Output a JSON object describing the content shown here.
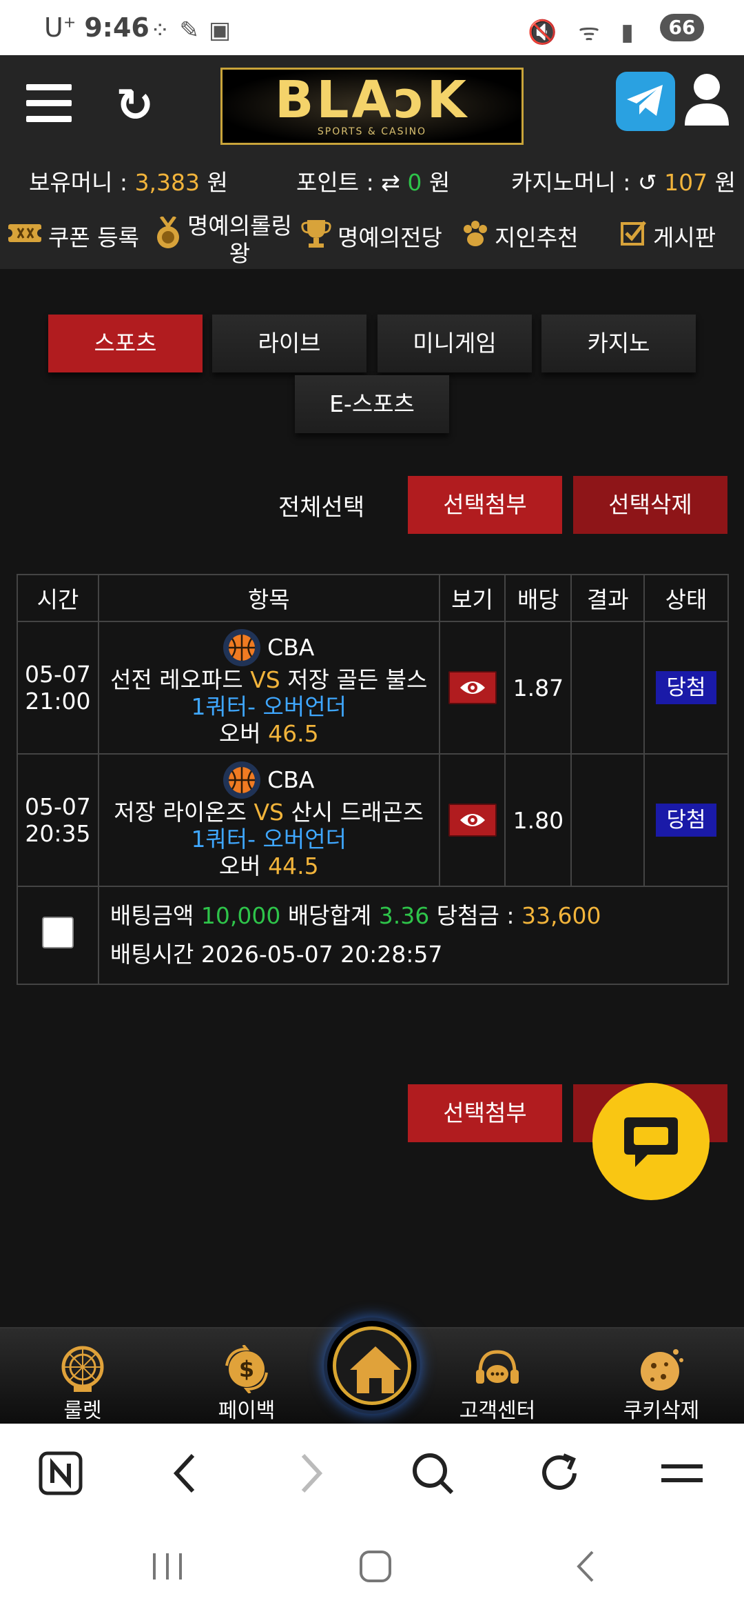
{
  "status_bar": {
    "carrier": "U",
    "carrier_sup": "+",
    "time": "9:46",
    "battery": "66"
  },
  "header": {
    "logo_text": "BLAɔK",
    "logo_sub": "SPORTS & CASINO"
  },
  "balances": {
    "money_label": "보유머니 :",
    "money_value": "3,383",
    "money_unit": "원",
    "point_label": "포인트 :",
    "point_value": "0",
    "point_unit": "원",
    "casino_label": "카지노머니 :",
    "casino_value": "107",
    "casino_unit": "원"
  },
  "nav": {
    "coupon": "쿠폰 등록",
    "honor_roll_1": "명예의롤링",
    "honor_roll_2": "왕",
    "hall_of_fame": "명예의전당",
    "referral": "지인추천",
    "board": "게시판"
  },
  "tabs": [
    "스포츠",
    "라이브",
    "미니게임",
    "카지노",
    "E-스포츠"
  ],
  "actions": {
    "select_all": "전체선택",
    "attach": "선택첨부",
    "delete": "선택삭제"
  },
  "table": {
    "headers": [
      "시간",
      "항목",
      "보기",
      "배당",
      "결과",
      "상태"
    ],
    "rows": [
      {
        "date": "05-07",
        "time": "21:00",
        "league": "CBA",
        "home": "선전 레오파드",
        "vs": "VS",
        "away": "저장 골든 불스",
        "market": "1쿼터- 오버언더",
        "pick": "오버",
        "line": "46.5",
        "odds": "1.87",
        "result": "",
        "status": "당첨"
      },
      {
        "date": "05-07",
        "time": "20:35",
        "league": "CBA",
        "home": "저장 라이온즈",
        "vs": "VS",
        "away": "산시 드래곤즈",
        "market": "1쿼터- 오버언더",
        "pick": "오버",
        "line": "44.5",
        "odds": "1.80",
        "result": "",
        "status": "당첨"
      }
    ],
    "summary": {
      "bet_amount_label": "배팅금액",
      "bet_amount": "10,000",
      "total_odds_label": "배당합계",
      "total_odds": "3.36",
      "winnings_label": "당첨금 :",
      "winnings": "33,600",
      "bet_time_label": "배팅시간",
      "bet_time": "2026-05-07 20:28:57"
    }
  },
  "bottom_actions": {
    "attach": "선택첨부"
  },
  "app_bar": [
    "룰렛",
    "페이백",
    "고객센터",
    "쿠키삭제"
  ],
  "colors": {
    "accent_red": "#b11c1f",
    "gold": "#f2b43b",
    "green": "#2ec44a",
    "blue": "#3fa7ff",
    "chat_yellow": "#f9c613"
  }
}
